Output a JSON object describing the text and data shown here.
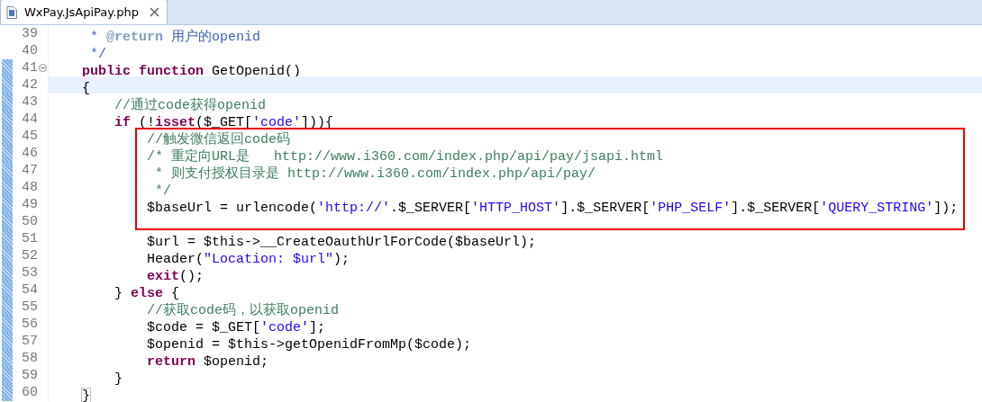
{
  "tab": {
    "title": "WxPay.JsApiPay.php",
    "selected": true
  },
  "lines": [
    {
      "number": "39",
      "tokens": [
        {
          "kind": "doc",
          "text": "     * "
        },
        {
          "kind": "doctag",
          "text": "@return"
        },
        {
          "kind": "doc",
          "text": " 用户的openid"
        }
      ]
    },
    {
      "number": "40",
      "tokens": [
        {
          "kind": "doc",
          "text": "     */"
        }
      ]
    },
    {
      "number": "41",
      "in_range": true,
      "fold": true,
      "tokens": [
        {
          "kind": "keyword",
          "text": "    public function"
        },
        {
          "kind": "plain",
          "text": " GetOpenid()"
        }
      ]
    },
    {
      "number": "42",
      "in_range": true,
      "current": true,
      "tokens": [
        {
          "kind": "plain",
          "text": "    {"
        }
      ]
    },
    {
      "number": "43",
      "in_range": true,
      "tokens": [
        {
          "kind": "comment",
          "text": "        //通过code获得openid"
        }
      ]
    },
    {
      "number": "44",
      "in_range": true,
      "tokens": [
        {
          "kind": "keyword",
          "text": "        if"
        },
        {
          "kind": "plain",
          "text": " (!"
        },
        {
          "kind": "keyword",
          "text": "isset"
        },
        {
          "kind": "plain",
          "text": "($_GET["
        },
        {
          "kind": "string",
          "text": "'code'"
        },
        {
          "kind": "plain",
          "text": "])){"
        }
      ]
    },
    {
      "number": "45",
      "in_range": true,
      "boxed": true,
      "tokens": [
        {
          "kind": "comment",
          "text": "            //触发微信返回code码"
        }
      ]
    },
    {
      "number": "46",
      "in_range": true,
      "boxed": true,
      "tokens": [
        {
          "kind": "comment",
          "text": "            /* 重定向URL是   http://www.i360.com/index.php/api/pay/jsapi.html"
        }
      ]
    },
    {
      "number": "47",
      "in_range": true,
      "boxed": true,
      "tokens": [
        {
          "kind": "comment",
          "text": "             * 则支付授权目录是 http://www.i360.com/index.php/api/pay/"
        }
      ]
    },
    {
      "number": "48",
      "in_range": true,
      "boxed": true,
      "tokens": [
        {
          "kind": "comment",
          "text": "             */"
        }
      ]
    },
    {
      "number": "49",
      "in_range": true,
      "boxed": true,
      "tokens": [
        {
          "kind": "plain",
          "text": "            $baseUrl = urlencode("
        },
        {
          "kind": "string",
          "text": "'http://'"
        },
        {
          "kind": "plain",
          "text": ".$_SERVER["
        },
        {
          "kind": "string",
          "text": "'HTTP_HOST'"
        },
        {
          "kind": "plain",
          "text": "].$_SERVER["
        },
        {
          "kind": "string",
          "text": "'PHP_SELF'"
        },
        {
          "kind": "plain",
          "text": "].$_SERVER["
        },
        {
          "kind": "string",
          "text": "'QUERY_STRING'"
        },
        {
          "kind": "plain",
          "text": "]);"
        }
      ]
    },
    {
      "number": "50",
      "in_range": true,
      "boxed": true
    },
    {
      "number": "51",
      "in_range": true,
      "tokens": [
        {
          "kind": "plain",
          "text": "            $url = $this->__CreateOauthUrlForCode($baseUrl);"
        }
      ]
    },
    {
      "number": "52",
      "in_range": true,
      "tokens": [
        {
          "kind": "plain",
          "text": "            Header("
        },
        {
          "kind": "string",
          "text": "\"Location: $url\""
        },
        {
          "kind": "plain",
          "text": ");"
        }
      ]
    },
    {
      "number": "53",
      "in_range": true,
      "tokens": [
        {
          "kind": "keyword",
          "text": "            exit"
        },
        {
          "kind": "plain",
          "text": "();"
        }
      ]
    },
    {
      "number": "54",
      "in_range": true,
      "tokens": [
        {
          "kind": "plain",
          "text": "        } "
        },
        {
          "kind": "keyword",
          "text": "else"
        },
        {
          "kind": "plain",
          "text": " {"
        }
      ]
    },
    {
      "number": "55",
      "in_range": true,
      "tokens": [
        {
          "kind": "comment",
          "text": "            //获取code码，以获取openid"
        }
      ]
    },
    {
      "number": "56",
      "in_range": true,
      "tokens": [
        {
          "kind": "plain",
          "text": "            $code = $_GET["
        },
        {
          "kind": "string",
          "text": "'code'"
        },
        {
          "kind": "plain",
          "text": "];"
        }
      ]
    },
    {
      "number": "57",
      "in_range": true,
      "tokens": [
        {
          "kind": "plain",
          "text": "            $openid = $this->getOpenidFromMp($code);"
        }
      ]
    },
    {
      "number": "58",
      "in_range": true,
      "tokens": [
        {
          "kind": "keyword",
          "text": "            return"
        },
        {
          "kind": "plain",
          "text": " $openid;"
        }
      ]
    },
    {
      "number": "59",
      "in_range": true,
      "tokens": [
        {
          "kind": "plain",
          "text": "        }"
        }
      ]
    },
    {
      "number": "60",
      "in_range": true,
      "tokens": [
        {
          "kind": "match",
          "text": "    }"
        }
      ]
    }
  ]
}
